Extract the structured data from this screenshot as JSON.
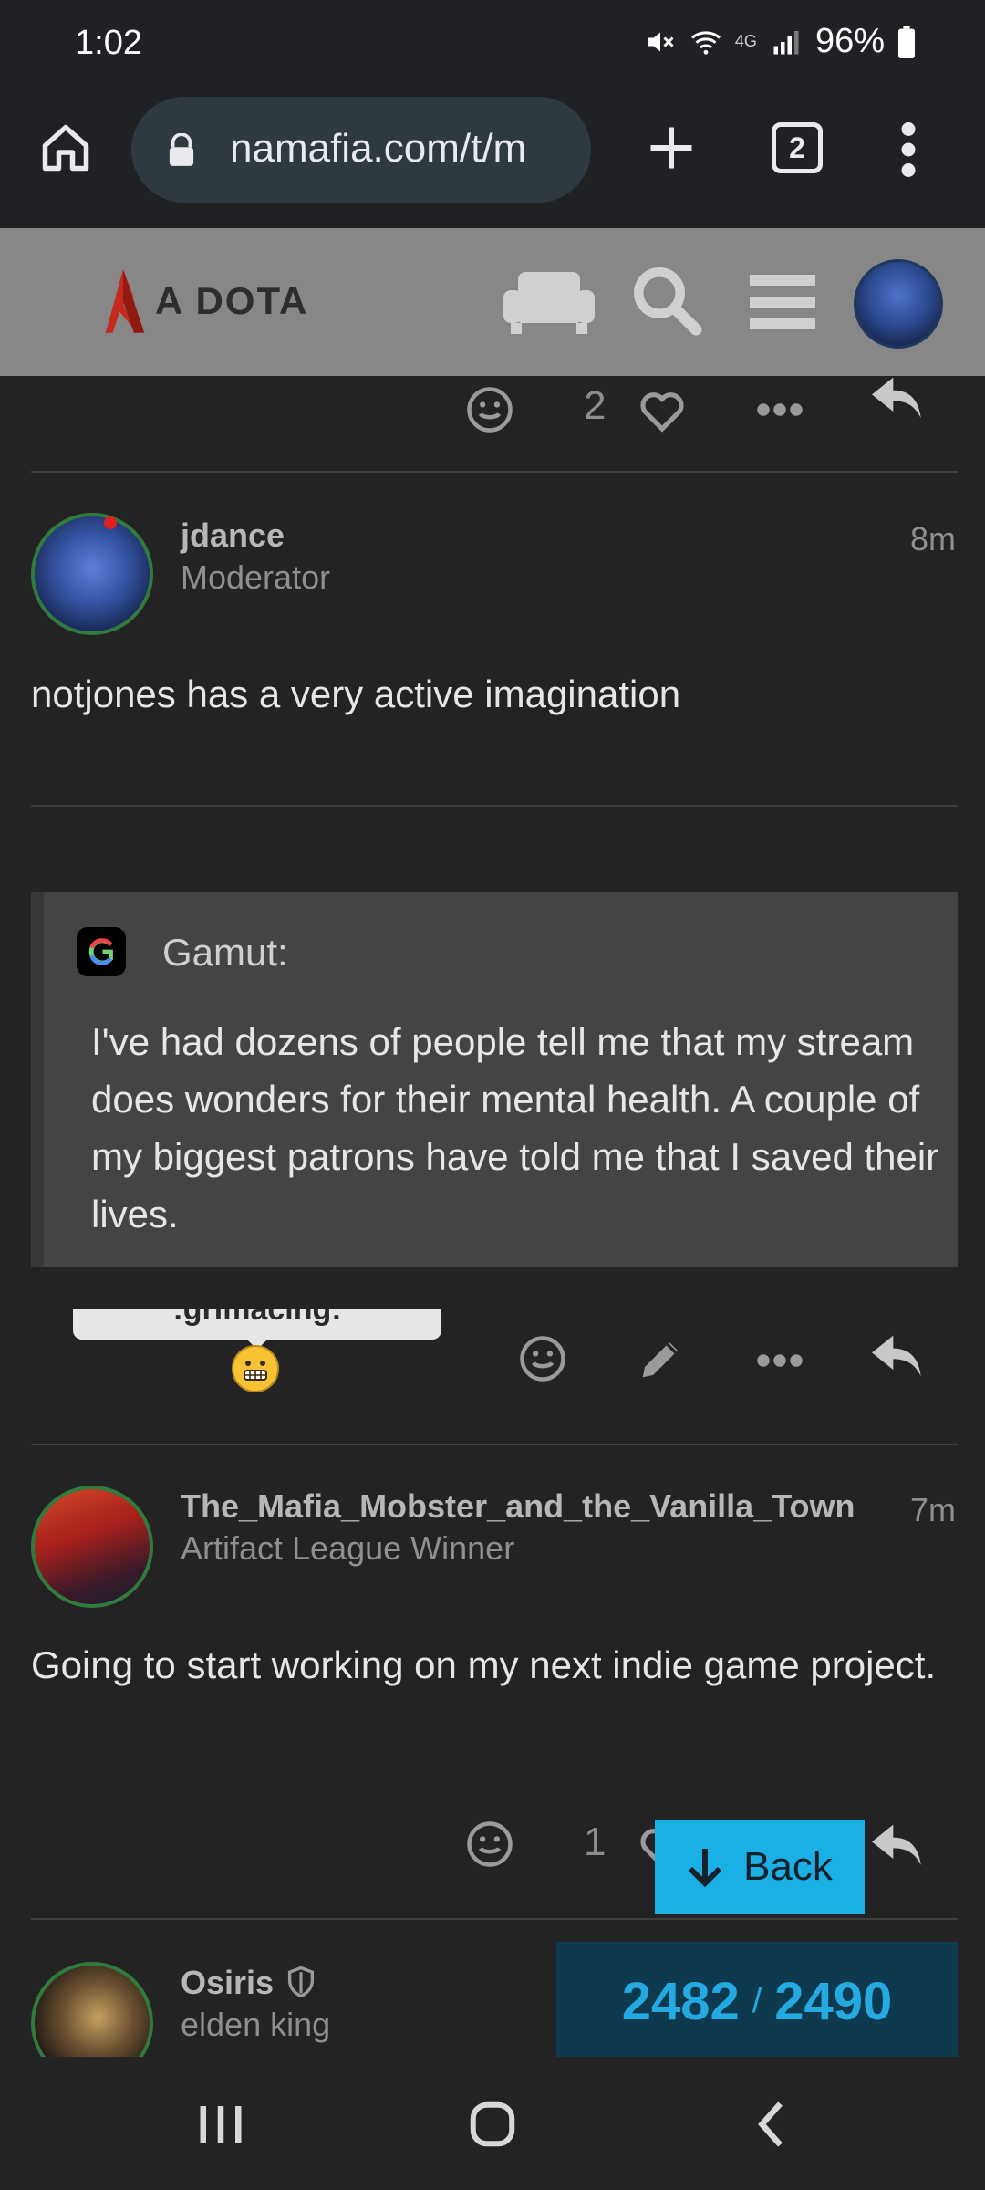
{
  "status_bar": {
    "time": "1:02",
    "network": "4G",
    "battery": "96%"
  },
  "browser": {
    "url": "namafia.com/t/m",
    "tab_count": "2"
  },
  "site": {
    "logo_text": "A DOTA"
  },
  "posts": [
    {
      "reactions_count": "2"
    },
    {
      "username": "jdance",
      "user_title": "Moderator",
      "time": "8m",
      "body": "notjones has a very active imagination",
      "quote": {
        "author": "Gamut:",
        "text": "I've had dozens of people tell me that my stream does wonders for their mental health. A couple of my biggest patrons have told me that I saved their lives."
      },
      "tooltip": ":grimacing:"
    },
    {
      "username": "The_Mafia_Mobster_and_the_Vanilla_Town",
      "user_title": "Artifact League Winner",
      "time": "7m",
      "body": "Going to start working on my next indie game project.",
      "reactions_count": "1"
    },
    {
      "username": "Osiris",
      "user_title": "elden king"
    }
  ],
  "back_button": {
    "label": "Back"
  },
  "progress": {
    "current": "2482",
    "separator": "/",
    "total": "2490"
  },
  "colors": {
    "accent": "#1ab0e6",
    "background": "#232323",
    "header": "#878787"
  }
}
